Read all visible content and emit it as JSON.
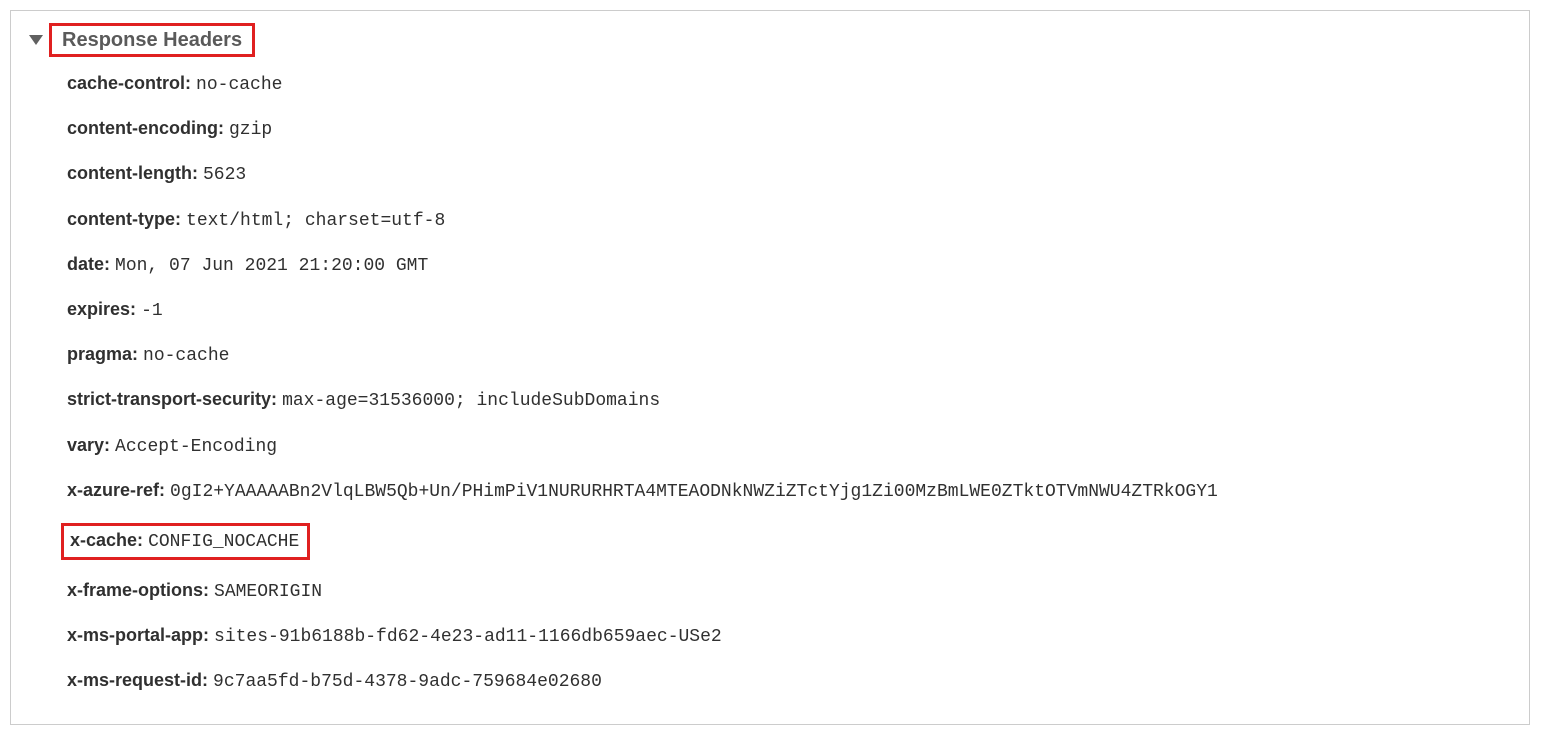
{
  "section_title": "Response Headers",
  "headers": [
    {
      "name": "cache-control:",
      "value": "no-cache"
    },
    {
      "name": "content-encoding:",
      "value": "gzip"
    },
    {
      "name": "content-length:",
      "value": "5623"
    },
    {
      "name": "content-type:",
      "value": "text/html; charset=utf-8"
    },
    {
      "name": "date:",
      "value": "Mon, 07 Jun 2021 21:20:00 GMT"
    },
    {
      "name": "expires:",
      "value": "-1"
    },
    {
      "name": "pragma:",
      "value": "no-cache"
    },
    {
      "name": "strict-transport-security:",
      "value": "max-age=31536000; includeSubDomains"
    },
    {
      "name": "vary:",
      "value": "Accept-Encoding"
    },
    {
      "name": "x-azure-ref:",
      "value": "0gI2+YAAAAABn2VlqLBW5Qb+Un/PHimPiV1NURURHRTA4MTEAODNkNWZiZTctYjg1Zi00MzBmLWE0ZTktOTVmNWU4ZTRkOGY1"
    },
    {
      "name": "x-cache:",
      "value": "CONFIG_NOCACHE"
    },
    {
      "name": "x-frame-options:",
      "value": "SAMEORIGIN"
    },
    {
      "name": "x-ms-portal-app:",
      "value": "sites-91b6188b-fd62-4e23-ad11-1166db659aec-USe2"
    },
    {
      "name": "x-ms-request-id:",
      "value": "9c7aa5fd-b75d-4378-9adc-759684e02680"
    }
  ],
  "highlighted_header_index": 10,
  "annotation_color": "#e02020"
}
